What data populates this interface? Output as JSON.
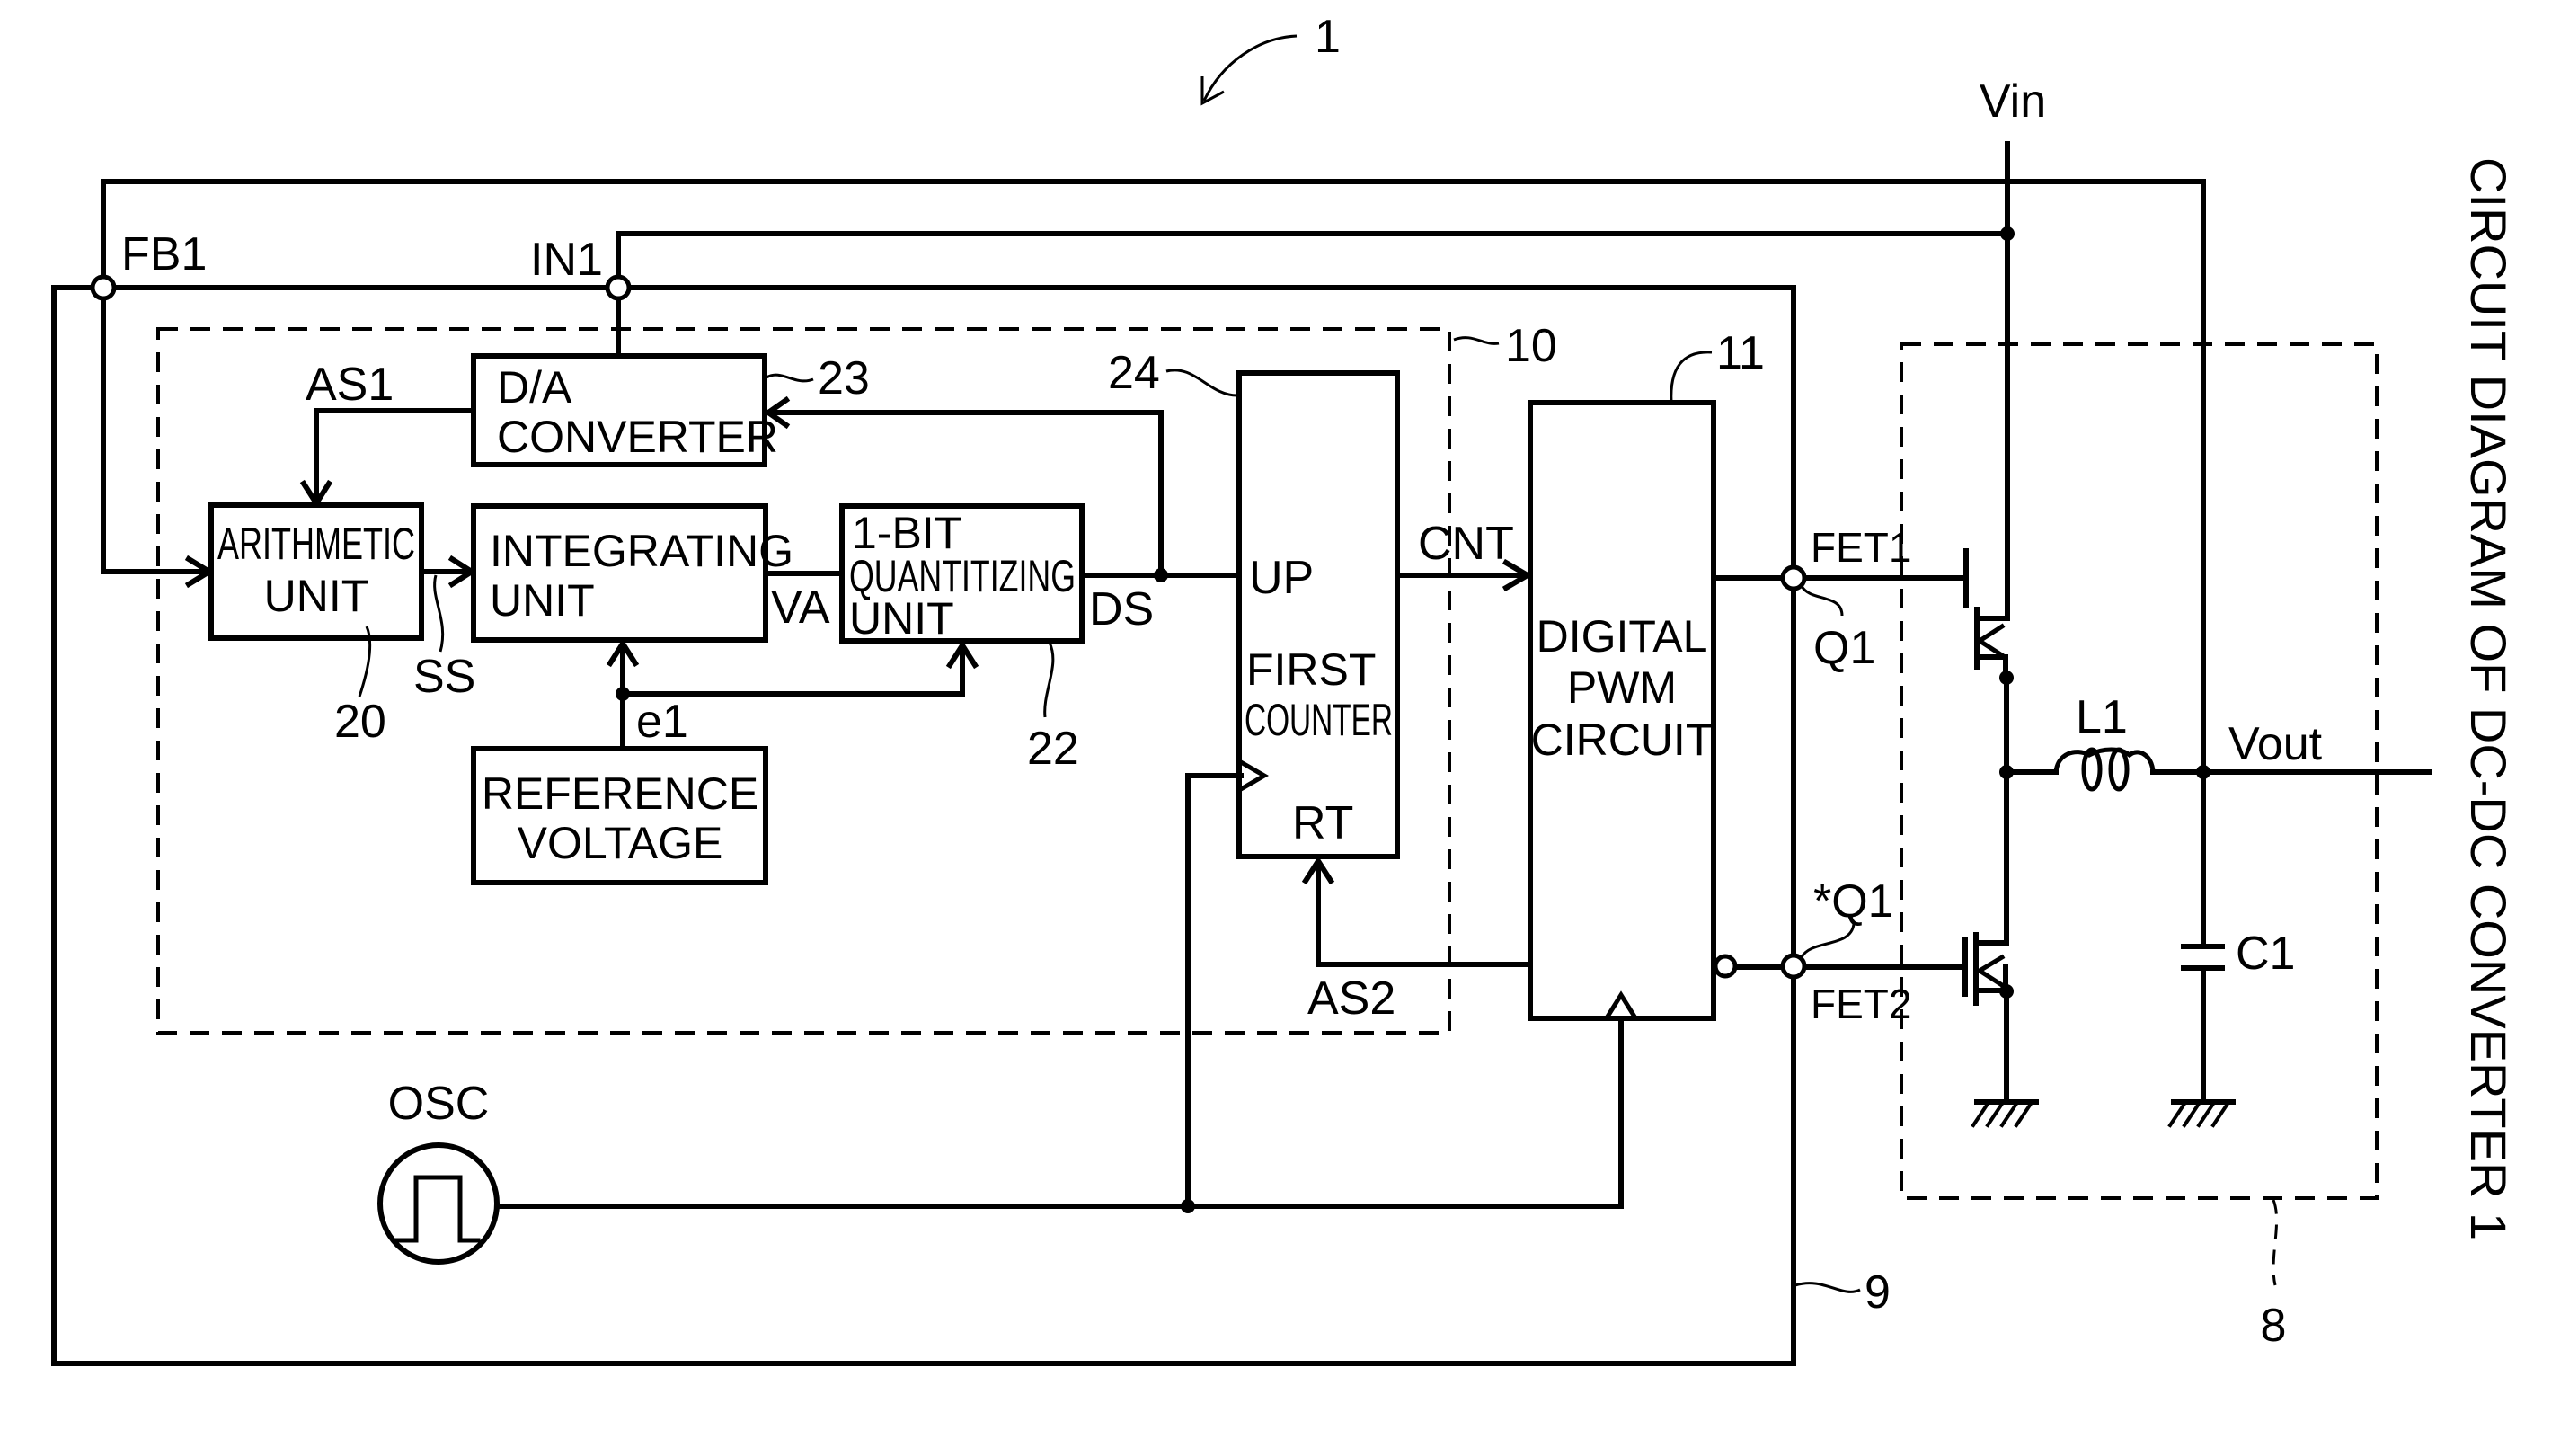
{
  "figure": {
    "title": "CIRCUIT DIAGRAM OF DC-DC CONVERTER 1",
    "figure_ref": "1"
  },
  "blocks": {
    "da_converter": [
      "D/A",
      "CONVERTER"
    ],
    "arithmetic_unit": [
      "ARITHMETIC",
      "UNIT"
    ],
    "integrating_unit": [
      "INTEGRATING",
      "UNIT"
    ],
    "quantizing_unit": [
      "1-BIT",
      "QUANTITIZING",
      "UNIT"
    ],
    "reference_voltage": [
      "REFERENCE",
      "VOLTAGE"
    ],
    "first_counter": [
      "FIRST",
      "COUNTER"
    ],
    "digital_pwm": [
      "DIGITAL",
      "PWM",
      "CIRCUIT"
    ],
    "oscillator": "OSC"
  },
  "ports": {
    "counter_up": "UP",
    "counter_rt": "RT"
  },
  "signals": {
    "fb1": "FB1",
    "in1": "IN1",
    "as1": "AS1",
    "as2": "AS2",
    "ss": "SS",
    "va": "VA",
    "ds": "DS",
    "e1": "e1",
    "cnt": "CNT",
    "q1": "Q1",
    "q1_bar": "*Q1",
    "fet1": "FET1",
    "fet2": "FET2",
    "vin": "Vin",
    "vout": "Vout",
    "l1": "L1",
    "c1": "C1"
  },
  "reference_numerals": {
    "control_circuit": "10",
    "pwm_circuit": "11",
    "arithmetic_unit": "20",
    "quantizing_unit": "22",
    "da_converter": "23",
    "first_counter": "24",
    "power_stage": "8",
    "loop": "9"
  }
}
